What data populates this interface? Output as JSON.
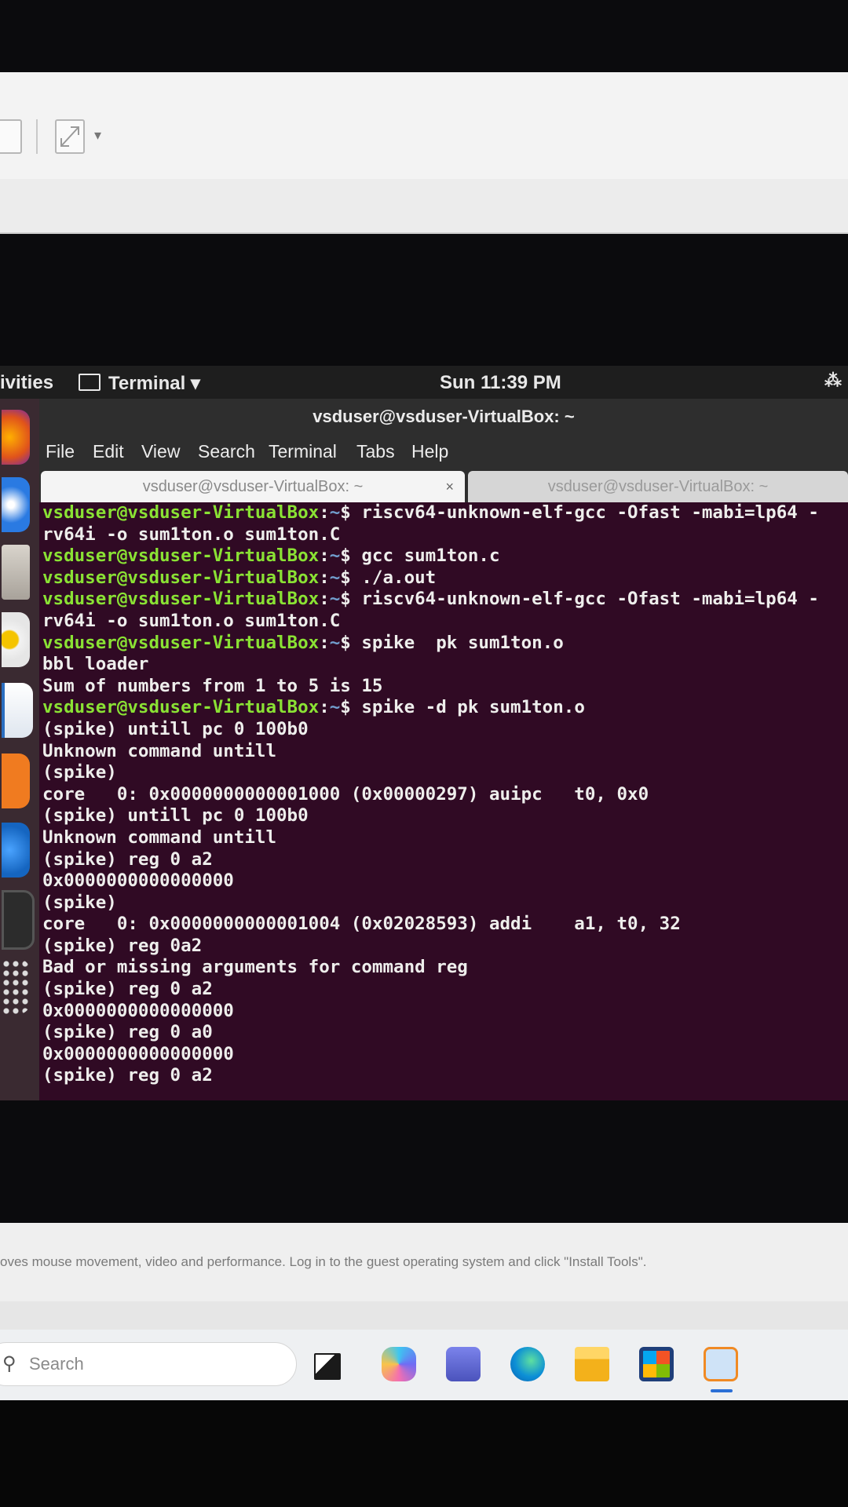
{
  "guest": {
    "activities": "ivities",
    "app_name": "Terminal ▾",
    "clock": "Sun 11:39 PM",
    "window_title": "vsduser@vsduser-VirtualBox: ~",
    "menu": [
      "File",
      "Edit",
      "View",
      "Search",
      "Terminal",
      "Tabs",
      "Help"
    ],
    "tabs": [
      {
        "label": "vsduser@vsduser-VirtualBox: ~",
        "active": true
      },
      {
        "label": "vsduser@vsduser-VirtualBox: ~",
        "active": false
      }
    ],
    "tab_close": "×",
    "dock_icons": [
      "firefox-icon",
      "thunderbird-icon",
      "files-icon",
      "rhythmbox-icon",
      "writer-icon",
      "software-icon",
      "help-icon",
      "terminal-icon",
      "apps-grid-icon"
    ]
  },
  "terminal": {
    "prompt_user": "vsduser@vsduser-VirtualBox",
    "prompt_sep": ":",
    "prompt_path": "~",
    "prompt_end": "$ ",
    "lines": [
      {
        "prompt": true,
        "text": "riscv64-unknown-elf-gcc -Ofast -mabi=lp64 -"
      },
      {
        "prompt": false,
        "text": "rv64i -o sum1ton.o sum1ton.C"
      },
      {
        "prompt": true,
        "text": "gcc sum1ton.c"
      },
      {
        "prompt": true,
        "text": "./a.out"
      },
      {
        "prompt": true,
        "text": "riscv64-unknown-elf-gcc -Ofast -mabi=lp64 -"
      },
      {
        "prompt": false,
        "text": "rv64i -o sum1ton.o sum1ton.C"
      },
      {
        "prompt": true,
        "text": "spike  pk sum1ton.o"
      },
      {
        "prompt": false,
        "text": "bbl loader"
      },
      {
        "prompt": false,
        "text": "Sum of numbers from 1 to 5 is 15"
      },
      {
        "prompt": true,
        "text": "spike -d pk sum1ton.o"
      },
      {
        "prompt": false,
        "text": "(spike) untill pc 0 100b0"
      },
      {
        "prompt": false,
        "text": "Unknown command untill"
      },
      {
        "prompt": false,
        "text": "(spike)"
      },
      {
        "prompt": false,
        "text": "core   0: 0x0000000000001000 (0x00000297) auipc   t0, 0x0"
      },
      {
        "prompt": false,
        "text": "(spike) untill pc 0 100b0"
      },
      {
        "prompt": false,
        "text": "Unknown command untill"
      },
      {
        "prompt": false,
        "text": "(spike) reg 0 a2"
      },
      {
        "prompt": false,
        "text": "0x0000000000000000"
      },
      {
        "prompt": false,
        "text": "(spike)"
      },
      {
        "prompt": false,
        "text": "core   0: 0x0000000000001004 (0x02028593) addi    a1, t0, 32"
      },
      {
        "prompt": false,
        "text": "(spike) reg 0a2"
      },
      {
        "prompt": false,
        "text": "Bad or missing arguments for command reg"
      },
      {
        "prompt": false,
        "text": "(spike) reg 0 a2"
      },
      {
        "prompt": false,
        "text": "0x0000000000000000"
      },
      {
        "prompt": false,
        "text": "(spike) reg 0 a0"
      },
      {
        "prompt": false,
        "text": "0x0000000000000000"
      },
      {
        "prompt": false,
        "text": "(spike) reg 0 a2"
      }
    ]
  },
  "host": {
    "notice": "oves mouse movement, video and performance. Log in to the guest operating system and click \"Install Tools\".",
    "search_placeholder": "Search",
    "taskbar_icons": [
      "task-view-icon",
      "copilot-icon",
      "teams-icon",
      "edge-icon",
      "file-explorer-icon",
      "store-icon",
      "virtualbox-icon"
    ]
  }
}
